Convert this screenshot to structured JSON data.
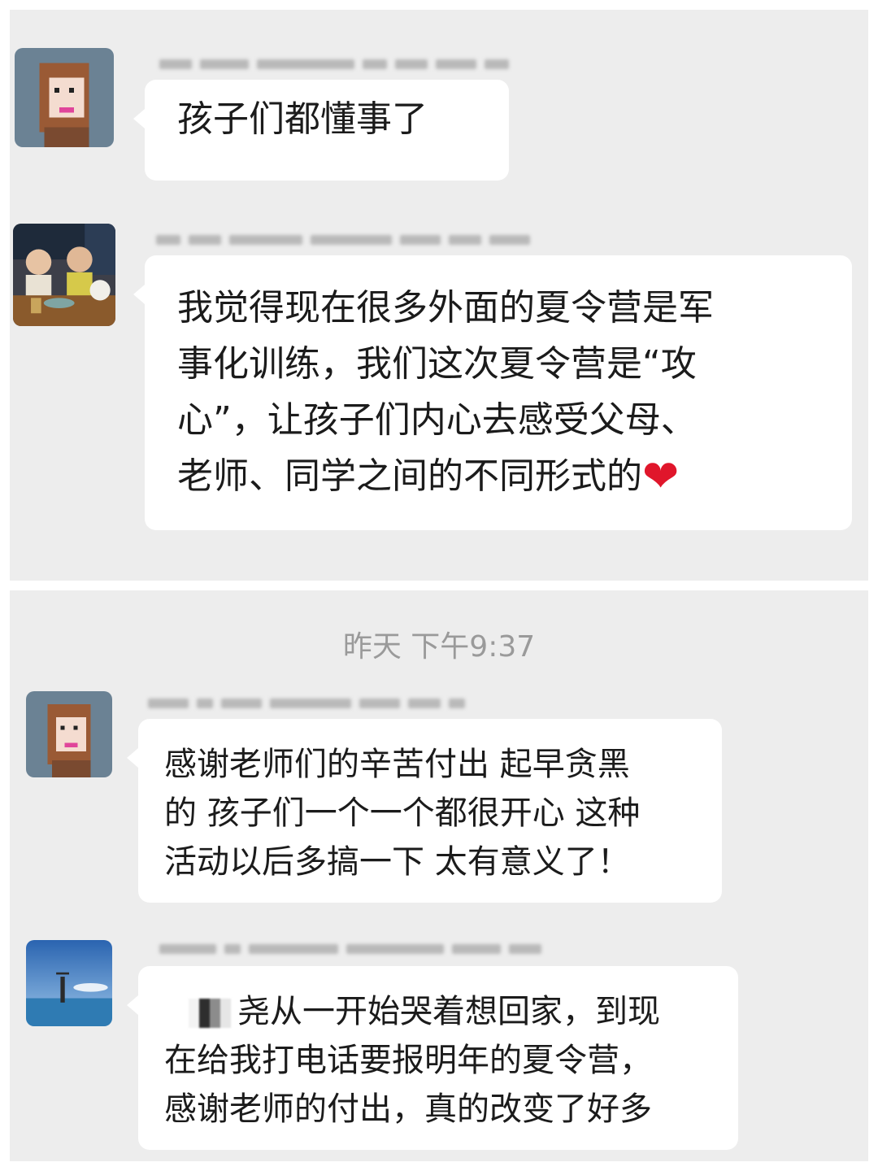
{
  "messages": [
    {
      "text": "孩子们都懂事了"
    },
    {
      "text": "我觉得现在很多外面的夏令营是军\n事化训练，我们这次夏令营是“攻\n心”，让孩子们内心去感受父母、\n老师、同学之间的不同形式的",
      "emoji": "heart-emoji"
    },
    {
      "text": "感谢老师们的辛苦付出 起早贪黑\n的 孩子们一个一个都很开心 这种\n活动以后多搞一下 太有意义了！"
    },
    {
      "text": "尧从一开始哭着想回家，到现\n在给我打电话要报明年的夏令营，\n感谢老师的付出，真的改变了好多"
    }
  ],
  "timestamp": "昨天 下午9:37",
  "colors": {
    "panel_background": "#ededed",
    "bubble_background": "#ffffff",
    "timestamp_text": "#9a9a9a",
    "heart": "#e0162b"
  }
}
